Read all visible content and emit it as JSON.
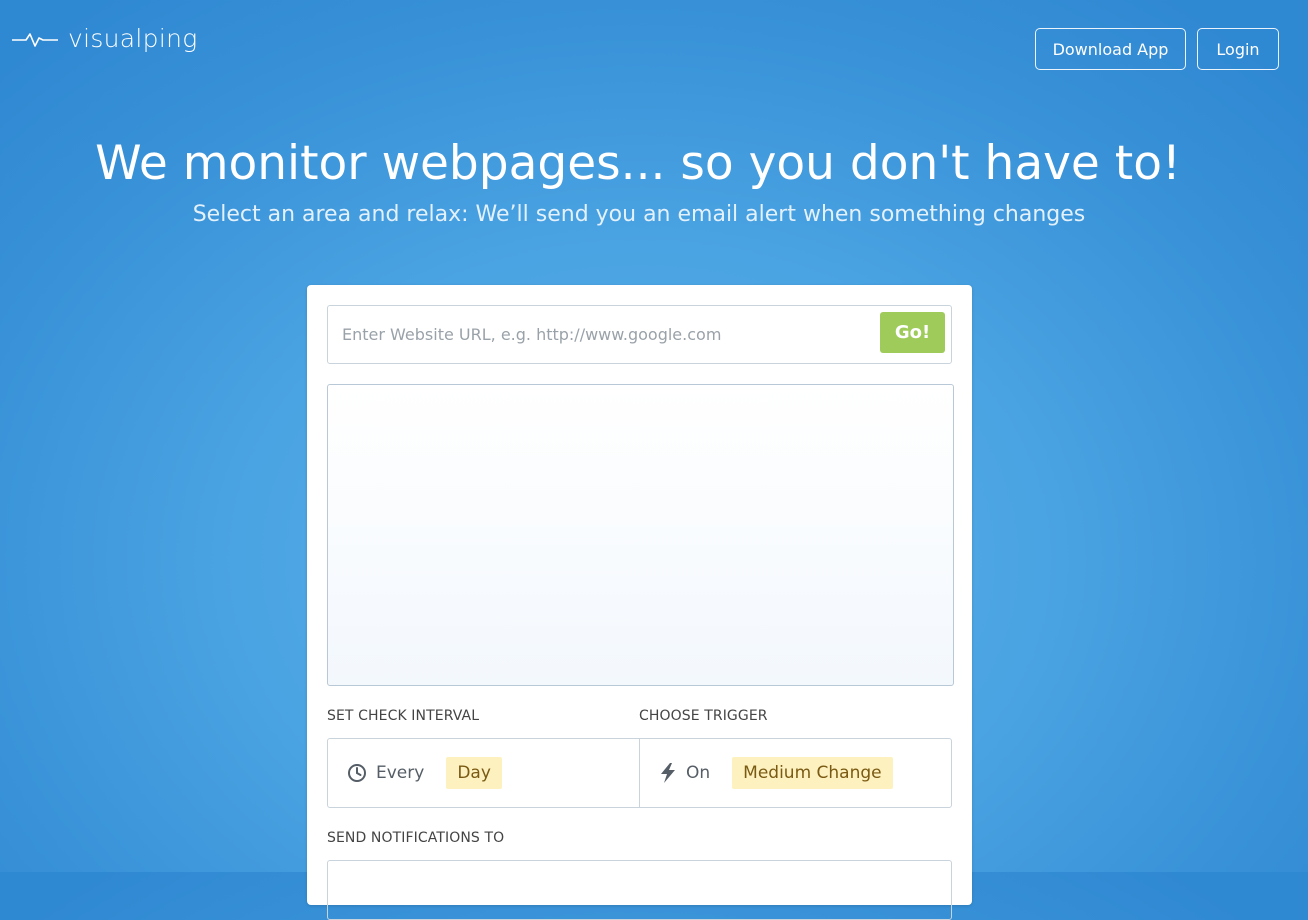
{
  "brand": {
    "name": "visualping",
    "logo_icon": "pulse-line-icon"
  },
  "header": {
    "download_label": "Download App",
    "login_label": "Login"
  },
  "hero": {
    "title": "We monitor webpages... so you don't have to!",
    "subtitle": "Select an area and relax: We’ll send you an email alert when something changes"
  },
  "form": {
    "url_placeholder": "Enter Website URL, e.g. http://www.google.com",
    "url_value": "",
    "go_label": "Go!",
    "interval_label": "SET CHECK INTERVAL",
    "interval_prefix": "Every",
    "interval_value": "Day",
    "interval_icon": "clock-icon",
    "trigger_label": "CHOOSE TRIGGER",
    "trigger_prefix": "On",
    "trigger_value": "Medium Change",
    "trigger_icon": "lightning-icon",
    "notify_label": "SEND NOTIFICATIONS TO"
  },
  "colors": {
    "background": "#4aa3e2",
    "go_button": "#9ecb5a",
    "chip_background": "#fdf1c0",
    "chip_text": "#7a5a12"
  }
}
